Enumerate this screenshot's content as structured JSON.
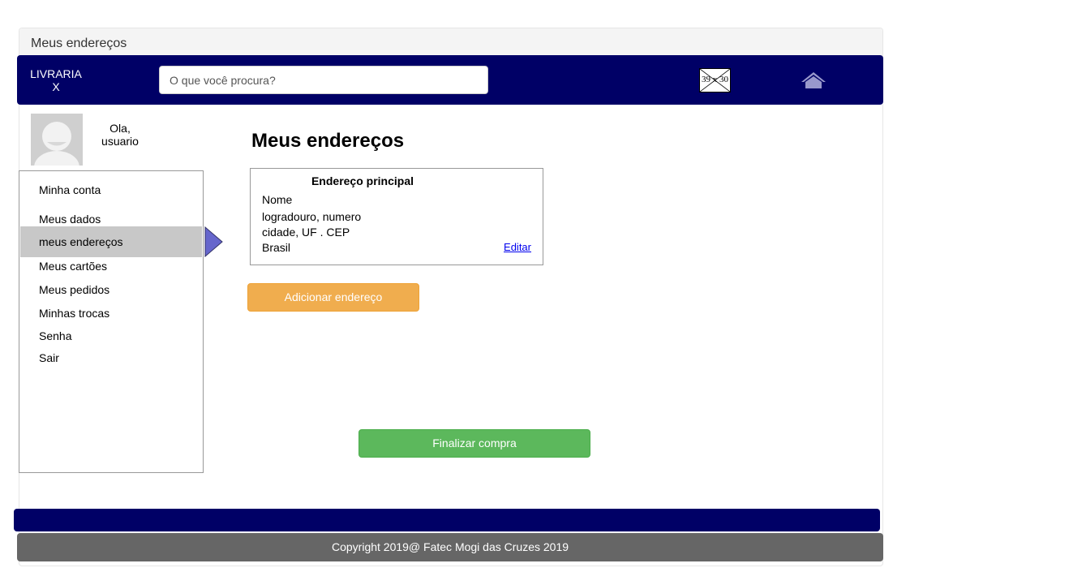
{
  "window": {
    "title": "Meus endereços"
  },
  "header": {
    "brand": "LIVRARIA X",
    "search_placeholder": "O que você procura?",
    "image_placeholder": "39 x 30",
    "home_icon": "home-icon",
    "background": "#000066"
  },
  "user": {
    "greeting": "Ola, usuario"
  },
  "sidebar": {
    "items": [
      {
        "label": "Minha conta"
      },
      {
        "label": "Meus dados"
      },
      {
        "label": "meus endereços",
        "active": true
      },
      {
        "label": "Meus cartões"
      },
      {
        "label": "Meus pedidos"
      },
      {
        "label": "Minhas trocas"
      },
      {
        "label": "Senha"
      },
      {
        "label": "Sair"
      }
    ],
    "active_color": "#c8c8c8",
    "arrow_color": "#6666cc"
  },
  "main": {
    "title": "Meus endereços",
    "address_card": {
      "title": "Endereço principal",
      "name": "Nome",
      "street": "logradouro, numero",
      "city": "cidade, UF . CEP",
      "country": "Brasil",
      "edit_label": "Editar"
    },
    "add_button": "Adicionar endereço",
    "finish_button": "Finalizar compra"
  },
  "footer": {
    "copyright": "Copyright 2019@ Fatec Mogi das Cruzes 2019"
  },
  "colors": {
    "warning": "#f0ad4e",
    "success": "#5cb85c",
    "footer_gray": "#666666"
  }
}
